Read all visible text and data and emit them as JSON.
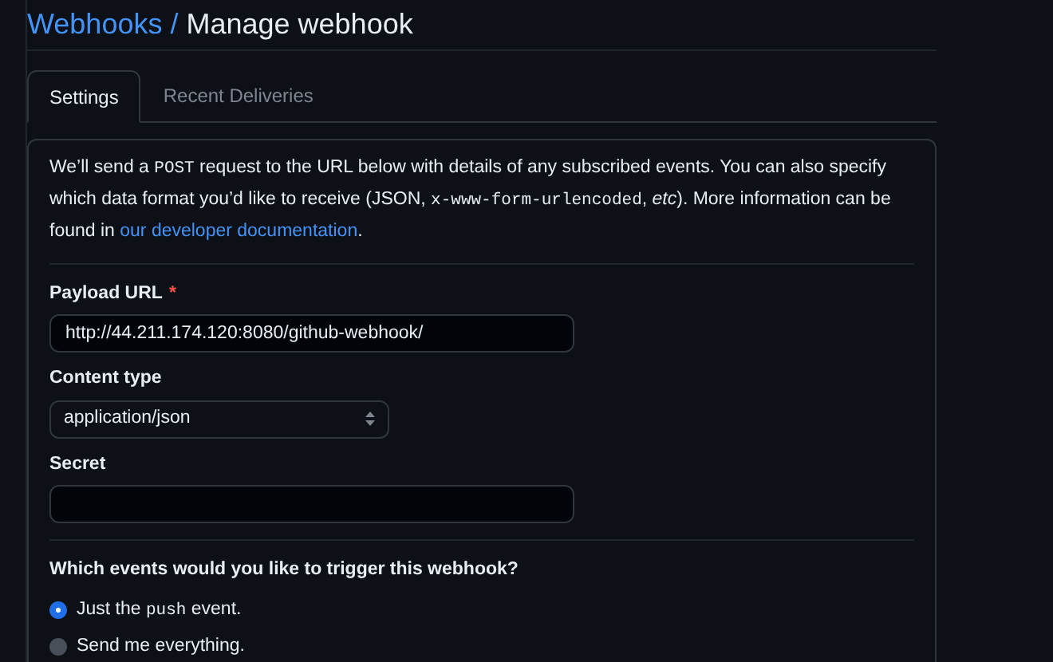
{
  "breadcrumb": {
    "parent": "Webhooks",
    "separator": "/",
    "current": "Manage webhook"
  },
  "tabs": [
    {
      "label": "Settings",
      "selected": true
    },
    {
      "label": "Recent Deliveries",
      "selected": false
    }
  ],
  "intro": [
    {
      "kind": "text",
      "text": "We’ll send a "
    },
    {
      "kind": "code",
      "text": "POST"
    },
    {
      "kind": "text",
      "text": " request to the URL below with details of any subscribed events. You can also specify which data format you’d like to receive (JSON, "
    },
    {
      "kind": "code",
      "text": "x-www-form-urlencoded"
    },
    {
      "kind": "text",
      "text": ", *etc*). More information can be found in "
    },
    {
      "kind": "link",
      "text": "our developer documentation"
    },
    {
      "kind": "text",
      "text": "."
    }
  ],
  "fields": [
    {
      "kind": "input",
      "label": "Payload URL",
      "required_mark": "*",
      "value": "http://44.211.174.120:8080/github-webhook/"
    },
    {
      "kind": "select",
      "label": "Content type",
      "value": "application/json"
    },
    {
      "kind": "input",
      "label": "Secret"
    }
  ],
  "events": {
    "question": "Which events would you like to trigger this webhook?",
    "options": [
      {
        "label": [
          {
            "kind": "text",
            "text": "Just the "
          },
          {
            "kind": "code",
            "text": "push"
          },
          {
            "kind": "text",
            "text": " event."
          }
        ],
        "selected": true
      },
      {
        "label": [
          {
            "kind": "text",
            "text": "Send me everything."
          }
        ],
        "selected": false
      }
    ]
  }
}
